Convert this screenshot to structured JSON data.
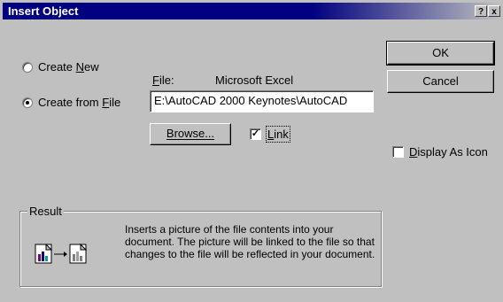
{
  "window": {
    "title": "Insert Object",
    "help_glyph": "?",
    "close_glyph": "x"
  },
  "buttons": {
    "ok": "OK",
    "cancel": "Cancel",
    "browse": "Browse..."
  },
  "options": {
    "create_new": {
      "pre": "Create ",
      "mnemonic": "N",
      "post": "ew",
      "selected": false
    },
    "create_from_file": {
      "pre": "Create from ",
      "mnemonic": "F",
      "post": "ile",
      "selected": true
    }
  },
  "file": {
    "label_mnemonic": "F",
    "label_rest": "ile:",
    "type": "Microsoft Excel",
    "value": "E:\\AutoCAD 2000 Keynotes\\AutoCAD"
  },
  "link": {
    "mnemonic": "L",
    "rest": "ink",
    "checked": true,
    "check_glyph": "✓"
  },
  "display_as_icon": {
    "mnemonic": "D",
    "rest": "isplay As Icon",
    "checked": false
  },
  "result": {
    "title": "Result",
    "text": "Inserts a picture of the file contents into your document.  The picture will be linked to the file so that changes to the file will be reflected in your document."
  },
  "colors": {
    "title_bar": "#000080",
    "face": "#c0c0c0"
  }
}
